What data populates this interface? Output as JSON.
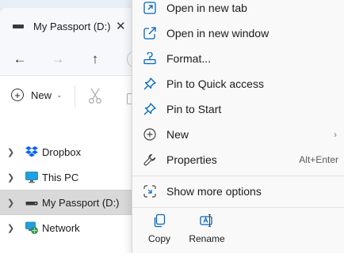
{
  "window": {
    "tab_title": "My Passport (D:)",
    "tab_close": "✕"
  },
  "nav": {
    "back": "←",
    "forward": "→",
    "up": "↑"
  },
  "commandbar": {
    "new_label": "New",
    "new_chevron": "⌄"
  },
  "tree": {
    "items": [
      {
        "label": "Dropbox",
        "icon": "dropbox-icon",
        "selected": false
      },
      {
        "label": "This PC",
        "icon": "monitor-icon",
        "selected": false
      },
      {
        "label": "My Passport (D:)",
        "icon": "drive-icon",
        "selected": true
      },
      {
        "label": "Network",
        "icon": "network-icon",
        "selected": false
      }
    ]
  },
  "context_menu": {
    "items": [
      {
        "label": "Open in new tab",
        "icon": "open-new-tab-icon"
      },
      {
        "label": "Open in new window",
        "icon": "open-new-window-icon"
      },
      {
        "label": "Format...",
        "icon": "format-icon"
      },
      {
        "label": "Pin to Quick access",
        "icon": "pin-icon"
      },
      {
        "label": "Pin to Start",
        "icon": "pin-icon"
      },
      {
        "label": "New",
        "icon": "plus-circle-icon",
        "submenu_arrow": "›"
      },
      {
        "label": "Properties",
        "icon": "wrench-icon",
        "shortcut": "Alt+Enter"
      },
      {
        "label": "Show more options",
        "icon": "show-more-options-icon"
      }
    ],
    "actions": [
      {
        "label": "Copy",
        "icon": "copy-icon"
      },
      {
        "label": "Rename",
        "icon": "rename-icon"
      }
    ]
  },
  "colors": {
    "accent": "#0067c0",
    "selection": "#d9d9d9",
    "menu_bg": "#f9f9f9",
    "tabbar_bg": "#e8eef7"
  }
}
